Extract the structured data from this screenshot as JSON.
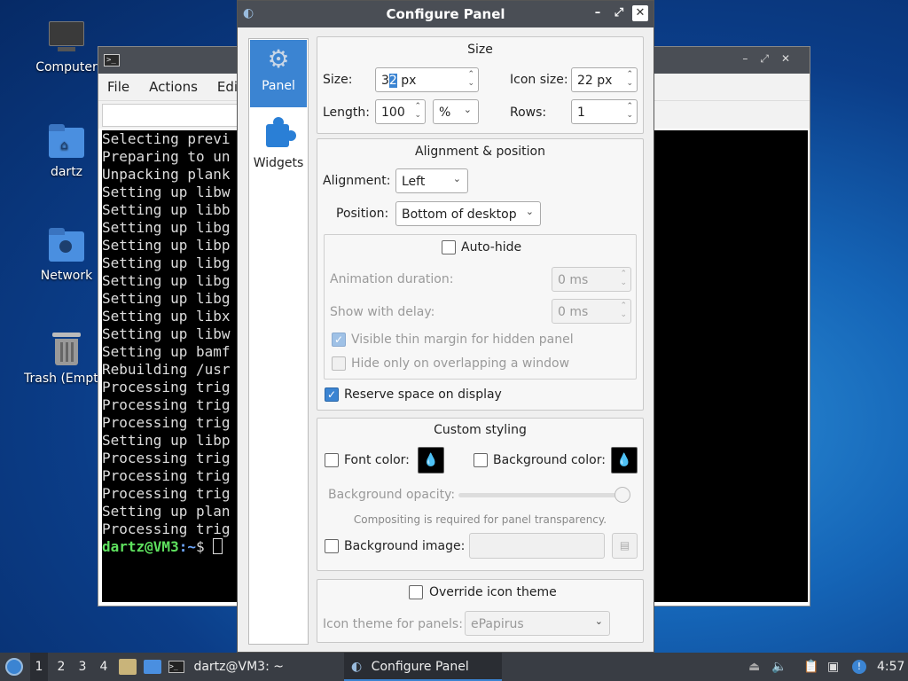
{
  "desktop": {
    "icons": [
      {
        "label": "Computer",
        "icon": "monitor-icon"
      },
      {
        "label": "dartz",
        "icon": "home-folder-icon"
      },
      {
        "label": "Network",
        "icon": "network-folder-icon"
      },
      {
        "label": "Trash (Empty)",
        "icon": "trash-icon"
      }
    ]
  },
  "terminal": {
    "menu": [
      "File",
      "Actions",
      "Edit"
    ],
    "lines": [
      "Selecting previ",
      "Preparing to un",
      "Unpacking plank",
      "Setting up libw",
      "Setting up libb",
      "Setting up libg",
      "Setting up libp",
      "Setting up libg",
      "Setting up libg",
      "Setting up libg",
      "Setting up libx",
      "Setting up libw",
      "Setting up bamf",
      "Rebuilding /usr",
      "Processing trig",
      "Processing trig",
      "Processing trig",
      "Setting up libp",
      "Processing trig",
      "Processing trig",
      "Processing trig",
      "Setting up plan",
      "Processing trig"
    ],
    "prompt_user": "dartz@VM3",
    "prompt_path": ":~",
    "prompt_sym": "$ "
  },
  "dialog": {
    "title": "Configure Panel",
    "side": {
      "panel": "Panel",
      "widgets": "Widgets"
    },
    "size": {
      "heading": "Size",
      "size_label": "Size:",
      "size_value_pre": "3",
      "size_value_sel": "2",
      "size_value_post": " px",
      "icon_size_label": "Icon size:",
      "icon_size_value": "22 px",
      "length_label": "Length:",
      "length_value": "100",
      "length_unit": "%",
      "rows_label": "Rows:",
      "rows_value": "1"
    },
    "align": {
      "heading": "Alignment & position",
      "alignment_label": "Alignment:",
      "alignment_value": "Left",
      "position_label": "Position:",
      "position_value": "Bottom of desktop",
      "autohide_label": "Auto-hide",
      "anim_label": "Animation duration:",
      "anim_value": "0 ms",
      "delay_label": "Show with delay:",
      "delay_value": "0 ms",
      "thin_margin_label": "Visible thin margin for hidden panel",
      "overlap_label": "Hide only on overlapping a window",
      "reserve_label": "Reserve space on display"
    },
    "styling": {
      "heading": "Custom styling",
      "font_color_label": "Font color:",
      "bg_color_label": "Background color:",
      "opacity_label": "Background opacity:",
      "opacity_value": 1.0,
      "compositing_note": "Compositing is required for panel transparency.",
      "bg_image_label": "Background image:"
    },
    "theme": {
      "override_label": "Override icon theme",
      "icon_theme_label": "Icon theme for panels:",
      "icon_theme_value": "ePapirus"
    }
  },
  "taskbar": {
    "desktops": [
      "1",
      "2",
      "3",
      "4"
    ],
    "terminal_task": "dartz@VM3: ~",
    "panel_task": "Configure Panel",
    "clock": "4:57"
  },
  "colors": {
    "accent": "#3b84d2",
    "titlebar": "#4a4e55",
    "taskbar": "#393d44"
  }
}
